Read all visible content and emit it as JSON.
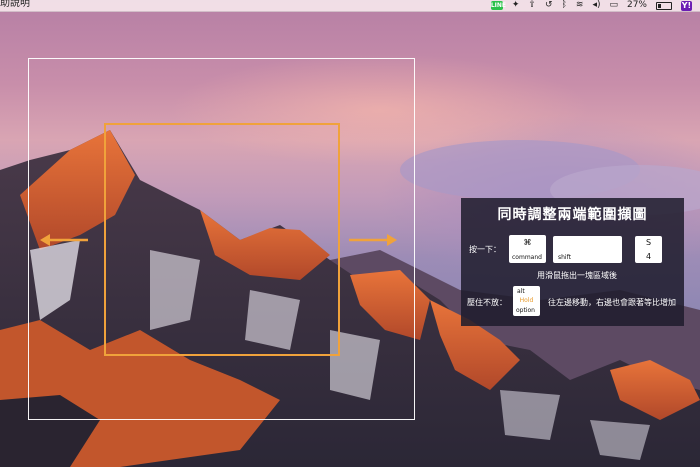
{
  "menubar": {
    "app_menu": "助說明",
    "icons": [
      "line-icon",
      "dropbox-icon",
      "upload-icon",
      "time-machine-icon",
      "bluetooth-icon",
      "wifi-icon",
      "volume-icon",
      "airplay-icon"
    ],
    "line_label": "LINE",
    "battery_text": "27%",
    "yahoo_label": "Y!"
  },
  "selection": {
    "outer_color": "#ffffff",
    "inner_color": "#f0a23b",
    "arrow_color": "#f0a23b"
  },
  "tip_panel": {
    "title": "同時調整兩端範圍擷圖",
    "press_once_label": "按一下：",
    "keys_step1": {
      "command_symbol": "⌘",
      "command_label": "command",
      "shift_label": "shift",
      "s4_top": "S",
      "s4_bottom": "4"
    },
    "step1_note": "用滑鼠拖出一塊區域後",
    "hold_label": "壓住不放：",
    "alt_key": {
      "top": "alt",
      "middle": "Hold",
      "bottom": "option"
    },
    "step2_note": "往左邊移動，右邊也會跟著等比增加"
  }
}
